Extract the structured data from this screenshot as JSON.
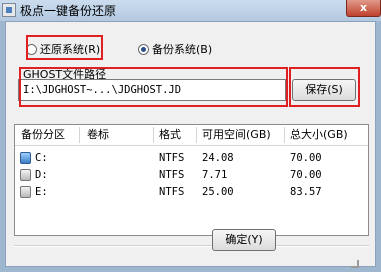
{
  "window": {
    "title": "极点一键备份还原",
    "close_label": "x"
  },
  "mode": {
    "restore_label": "还原系统(R)",
    "backup_label": "备份系统(B)",
    "selected": "backup"
  },
  "path": {
    "label": "GHOST文件路径",
    "value": "I:\\JDGHOST~...\\JDGHOST.JD",
    "save_label": "保存(S)"
  },
  "table": {
    "columns": [
      "备份分区",
      "卷标",
      "格式",
      "可用空间(GB)",
      "总大小(GB)"
    ],
    "rows": [
      {
        "partition": "C:",
        "label": "",
        "format": "NTFS",
        "free": "24.08",
        "total": "70.00",
        "icon": "system-drive-icon"
      },
      {
        "partition": "D:",
        "label": "",
        "format": "NTFS",
        "free": "7.71",
        "total": "70.00",
        "icon": "drive-icon"
      },
      {
        "partition": "E:",
        "label": "",
        "format": "NTFS",
        "free": "25.00",
        "total": "83.57",
        "icon": "drive-icon"
      }
    ]
  },
  "ok_label": "确定(Y)",
  "colors": {
    "highlight": "#e02020",
    "title_bar": "#b3c9e0",
    "selection_dot": "#2a4f8a"
  }
}
